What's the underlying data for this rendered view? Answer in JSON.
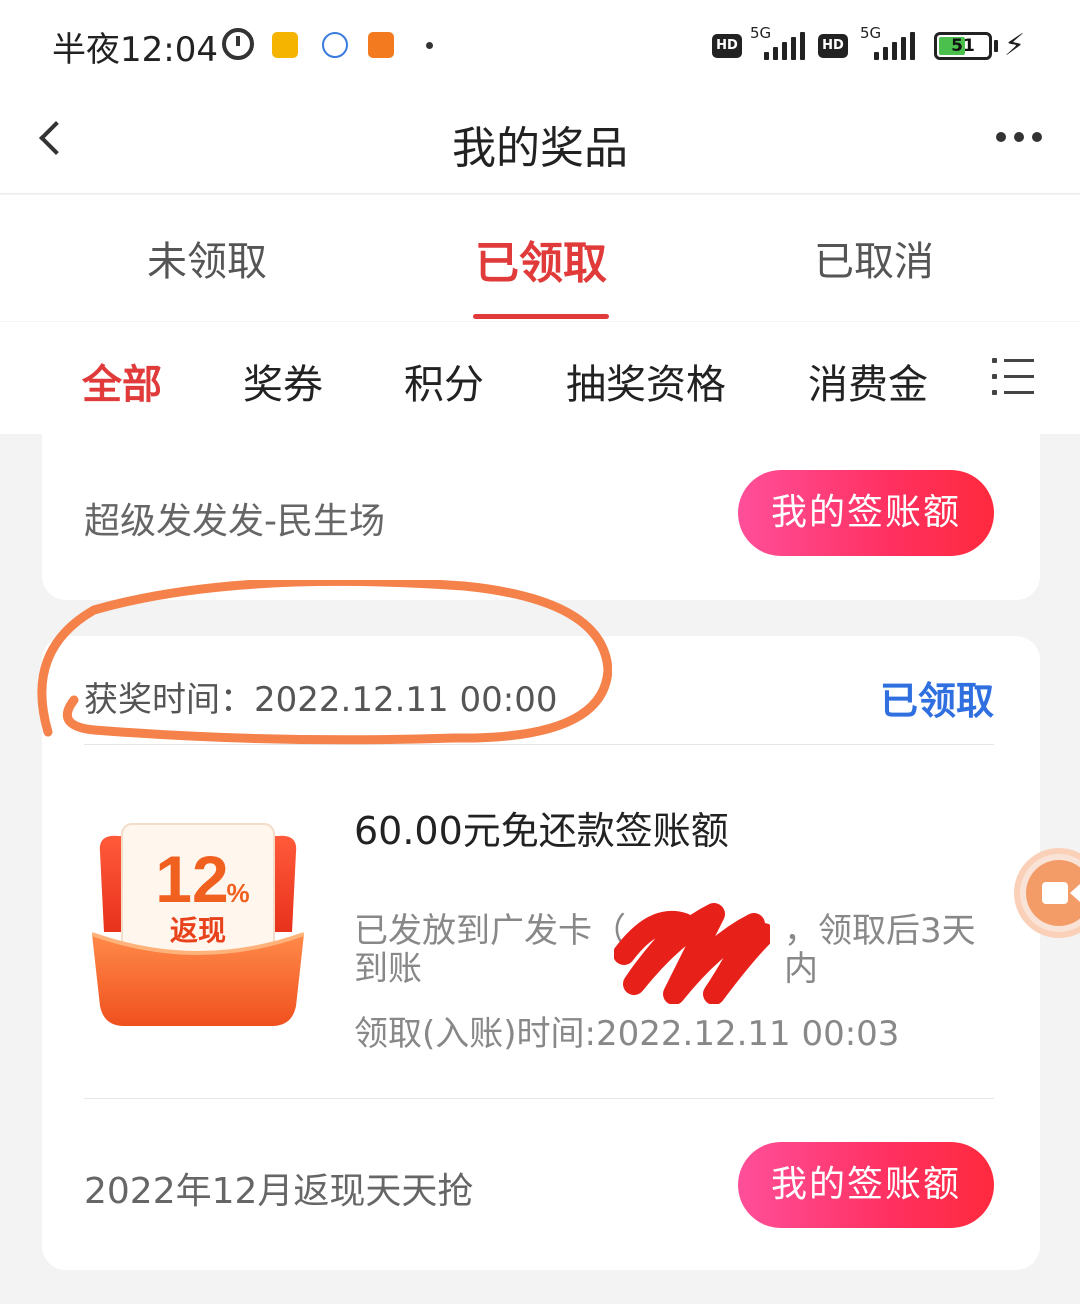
{
  "status_bar": {
    "time": "半夜12:04",
    "network_1": "5G",
    "network_2": "5G",
    "hd_1": "HD",
    "hd_2": "HD",
    "battery": "51"
  },
  "nav": {
    "title": "我的奖品"
  },
  "tabs": [
    {
      "label": "未领取"
    },
    {
      "label": "已领取"
    },
    {
      "label": "已取消"
    }
  ],
  "filters": [
    {
      "label": "全部"
    },
    {
      "label": "奖券"
    },
    {
      "label": "积分"
    },
    {
      "label": "抽奖资格"
    },
    {
      "label": "消费金"
    }
  ],
  "card1": {
    "activity": "超级发发发-民生场",
    "button": "我的签账额"
  },
  "card2": {
    "award_time": "获奖时间：2022.12.11 00:00",
    "status": "已领取",
    "prize_name": "60.00元免还款签账额",
    "prize_desc_head": "已发放到广发卡（",
    "prize_desc_tail": "，领取后3天内",
    "prize_desc_line2": "到账",
    "prize_receive_time": "领取(入账)时间:2022.12.11 00:03",
    "icon_percent_big": "12",
    "icon_percent_sign": "%",
    "icon_label": "返现",
    "activity": "2022年12月返现天天抢",
    "button": "我的签账额"
  },
  "colors": {
    "accent_red": "#e03a3a",
    "status_blue": "#2f6fe0",
    "annotation_orange": "#f5824a"
  }
}
